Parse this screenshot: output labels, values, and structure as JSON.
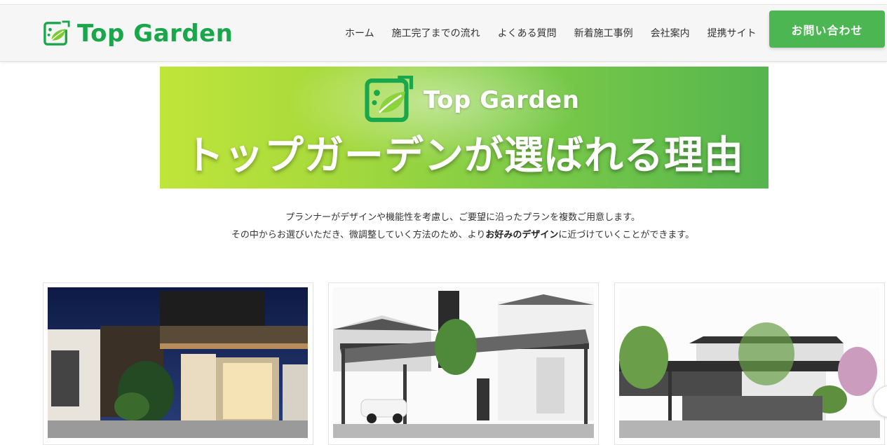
{
  "brand": {
    "name": "Top Garden",
    "color": "#1aa64a",
    "icon": "leaf-logo-icon"
  },
  "nav": {
    "items": [
      {
        "label": "ホーム"
      },
      {
        "label": "施工完了までの流れ"
      },
      {
        "label": "よくある質問"
      },
      {
        "label": "新着施工事例"
      },
      {
        "label": "会社案内"
      },
      {
        "label": "提携サイト"
      }
    ],
    "contact_label": "お問い合わせ",
    "contact_color": "#4cb652"
  },
  "banner": {
    "brand": "Top Garden",
    "headline": "トップガーデンが選ばれる理由"
  },
  "intro": {
    "line1": "プランナーがデザインや機能性を考慮し、ご要望に沿ったプランを複数ご用意します。",
    "line2_before": "その中からお選びいただき、微調整していく方法のため、より",
    "line2_bold": "お好みのデザイン",
    "line2_after": "に近づけていくことができます。"
  },
  "cards": [
    {
      "image": "night-exterior-house-photo"
    },
    {
      "image": "carport-modern-house-photo"
    },
    {
      "image": "garden-modern-house-photo"
    }
  ]
}
